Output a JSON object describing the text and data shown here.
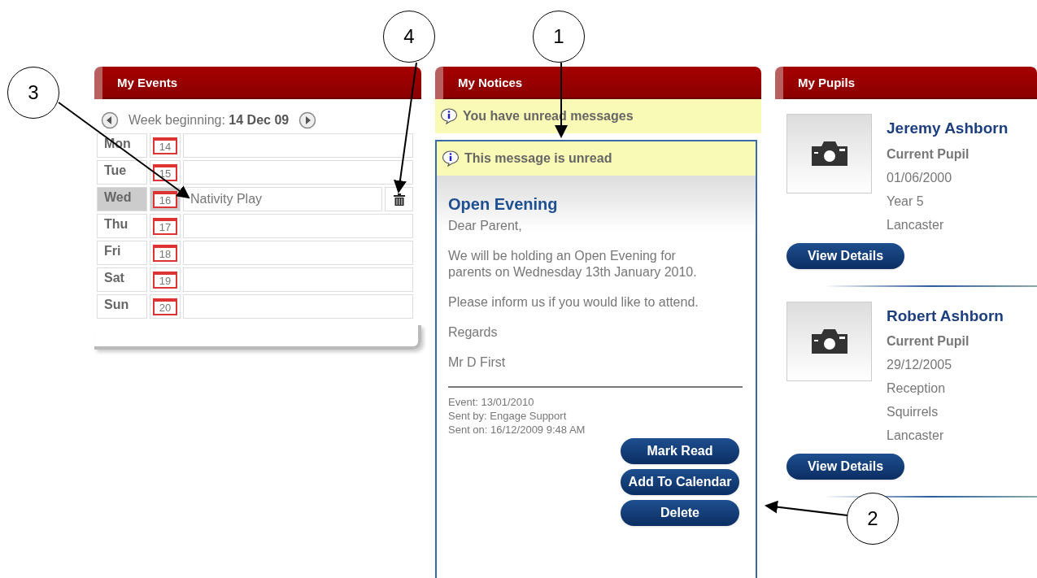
{
  "events": {
    "title": "My Events",
    "week_label": "Week beginning:",
    "week_value": "14 Dec 09",
    "days": [
      {
        "day": "Mon",
        "date": "14",
        "selected": false
      },
      {
        "day": "Tue",
        "date": "15",
        "selected": false
      },
      {
        "day": "Wed",
        "date": "16",
        "selected": true,
        "event": "Nativity Play"
      },
      {
        "day": "Thu",
        "date": "17",
        "selected": false
      },
      {
        "day": "Fri",
        "date": "18",
        "selected": false
      },
      {
        "day": "Sat",
        "date": "19",
        "selected": false
      },
      {
        "day": "Sun",
        "date": "20",
        "selected": false
      }
    ]
  },
  "notices": {
    "title": "My Notices",
    "banner": "You have unread messages",
    "message": {
      "status": "This message is unread",
      "unread": true,
      "subject": "Open Evening",
      "paragraphs": [
        "Dear Parent,",
        "We will be holding an Open Evening for parents on Wednesday 13th January 2010.",
        "Please inform us if you would like to attend.",
        "Regards",
        "Mr D First"
      ],
      "meta": [
        "Event: 13/01/2010",
        "Sent by: Engage Support",
        "Sent on: 16/12/2009 9:48 AM"
      ],
      "buttons": [
        "Mark Read",
        "Add To Calendar",
        "Delete"
      ]
    }
  },
  "pupils": {
    "title": "My Pupils",
    "items": [
      {
        "name": "Jeremy Ashborn",
        "details": [
          "Current Pupil",
          "01/06/2000",
          "Year 5",
          "Lancaster"
        ],
        "button": "View Details"
      },
      {
        "name": "Robert Ashborn",
        "details": [
          "Current Pupil",
          "29/12/2005",
          "Reception",
          "Squirrels",
          "Lancaster"
        ],
        "button": "View Details"
      }
    ]
  },
  "callouts": [
    "3",
    "4",
    "1",
    "2"
  ]
}
